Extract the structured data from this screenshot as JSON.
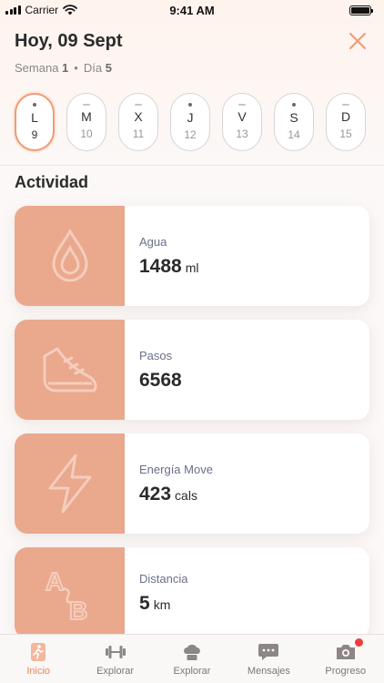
{
  "status_bar": {
    "carrier": "Carrier",
    "time": "9:41 AM"
  },
  "header": {
    "date_title": "Hoy, 09 Sept",
    "week_label": "Semana",
    "week_num": "1",
    "day_label": "Día",
    "day_num": "5"
  },
  "days": [
    {
      "letter": "L",
      "num": "9"
    },
    {
      "letter": "M",
      "num": "10"
    },
    {
      "letter": "X",
      "num": "11"
    },
    {
      "letter": "J",
      "num": "12"
    },
    {
      "letter": "V",
      "num": "13"
    },
    {
      "letter": "S",
      "num": "14"
    },
    {
      "letter": "D",
      "num": "15"
    }
  ],
  "section_title": "Actividad",
  "cards": [
    {
      "label": "Agua",
      "value": "1488",
      "unit": "ml",
      "icon": "water-drop-icon"
    },
    {
      "label": "Pasos",
      "value": "6568",
      "unit": "",
      "icon": "sneaker-icon"
    },
    {
      "label": "Energía Move",
      "value": "423",
      "unit": "cals",
      "icon": "lightning-icon"
    },
    {
      "label": "Distancia",
      "value": "5",
      "unit": "km",
      "icon": "distance-icon"
    }
  ],
  "tabs": [
    {
      "label": "Inicio",
      "icon": "runner-icon"
    },
    {
      "label": "Explorar",
      "icon": "dumbbell-icon"
    },
    {
      "label": "Explorar",
      "icon": "chef-hat-icon"
    },
    {
      "label": "Mensajes",
      "icon": "chat-bubble-icon"
    },
    {
      "label": "Progreso",
      "icon": "camera-icon"
    }
  ],
  "colors": {
    "accent": "#e9865b",
    "card_thumb": "#eaa88d",
    "notification": "#f03c3c"
  }
}
